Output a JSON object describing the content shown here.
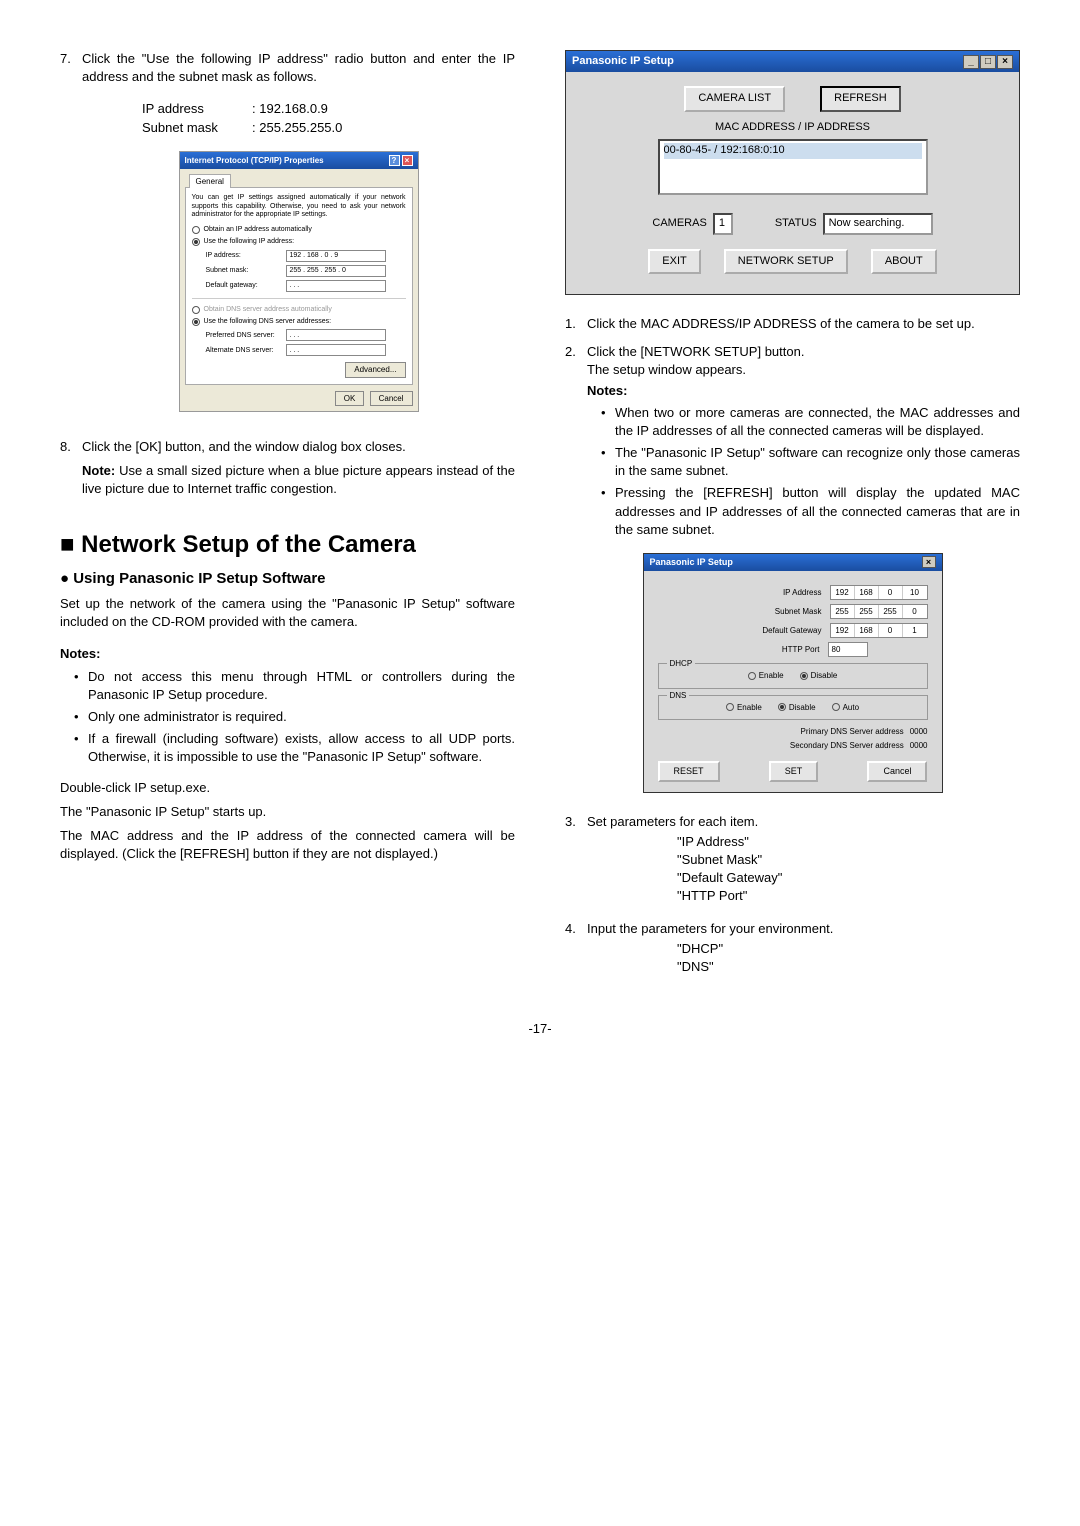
{
  "page_number": "-17-",
  "left": {
    "step7": {
      "num": "7.",
      "text": "Click the \"Use the following IP address\" radio button and enter the IP address and the subnet mask as follows.",
      "ip_label": "IP address",
      "ip_value": "192.168.0.9",
      "mask_label": "Subnet mask",
      "mask_value": "255.255.255.0"
    },
    "tcpip": {
      "title": "Internet Protocol (TCP/IP) Properties",
      "tab": "General",
      "desc": "You can get IP settings assigned automatically if your network supports this capability. Otherwise, you need to ask your network administrator for the appropriate IP settings.",
      "r_auto": "Obtain an IP address automatically",
      "r_use": "Use the following IP address:",
      "f_ip_l": "IP address:",
      "f_ip_v": "192 . 168 .  0  .  9",
      "f_mask_l": "Subnet mask:",
      "f_mask_v": "255 . 255 . 255 .  0",
      "f_gw_l": "Default gateway:",
      "f_gw_v": " .       .       .  ",
      "r_dns_auto": "Obtain DNS server address automatically",
      "r_dns_use": "Use the following DNS server addresses:",
      "f_pdns_l": "Preferred DNS server:",
      "f_adns_l": "Alternate DNS server:",
      "btn_adv": "Advanced...",
      "btn_ok": "OK",
      "btn_cancel": "Cancel"
    },
    "step8": {
      "num": "8.",
      "text": "Click the [OK] button, and the window dialog box closes.",
      "note_label": "Note:",
      "note_text": " Use a small sized picture when a blue picture appears instead of the live picture due to Internet traffic congestion."
    },
    "heading": "■ Network Setup of the Camera",
    "subheading": "● Using Panasonic IP Setup Software",
    "intro": "Set up the network of the camera using the \"Panasonic IP Setup\" software included on the CD-ROM provided with the camera.",
    "notes_hd": "Notes:",
    "notes": [
      "Do not access this menu through HTML or controllers during the Panasonic IP Setup procedure.",
      "Only one administrator is required.",
      "If a firewall (including software) exists, allow access to all UDP ports. Otherwise, it is impossible to use the \"Panasonic IP Setup\" software."
    ],
    "dc1": "Double-click IP setup.exe.",
    "dc2": "The \"Panasonic IP Setup\" starts up.",
    "dc3": "The MAC address and the IP address of the connected camera will be displayed. (Click the [REFRESH] button if they are not displayed.)"
  },
  "right": {
    "panawin": {
      "title": "Panasonic IP Setup",
      "btn_camlist": "CAMERA LIST",
      "btn_refresh": "REFRESH",
      "mac_label": "MAC ADDRESS / IP ADDRESS",
      "list_item": "00-80-45-            / 192:168:0:10",
      "cameras_l": "CAMERAS",
      "cameras_v": "1",
      "status_l": "STATUS",
      "status_v": "Now searching.",
      "btn_exit": "EXIT",
      "btn_netsetup": "NETWORK SETUP",
      "btn_about": "ABOUT"
    },
    "step1": {
      "num": "1.",
      "text": "Click the MAC ADDRESS/IP ADDRESS of the camera to be set up."
    },
    "step2": {
      "num": "2.",
      "text": "Click the [NETWORK SETUP] button.",
      "sub": "The setup window appears.",
      "notes_hd": "Notes:",
      "bullets": [
        "When two or more cameras are connected, the MAC addresses and the IP addresses of all the connected cameras will be displayed.",
        "The \"Panasonic IP Setup\" software can recognize only those cameras in the same subnet.",
        "Pressing the [REFRESH] button will display the updated MAC addresses and IP addresses of all the connected cameras that are in the same subnet."
      ]
    },
    "setupwin": {
      "title": "Panasonic IP Setup",
      "f_ip_l": "IP Address",
      "f_ip": [
        "192",
        "168",
        "0",
        "10"
      ],
      "f_mask_l": "Subnet Mask",
      "f_mask": [
        "255",
        "255",
        "255",
        "0"
      ],
      "f_gw_l": "Default Gateway",
      "f_gw": [
        "192",
        "168",
        "0",
        "1"
      ],
      "f_port_l": "HTTP Port",
      "f_port": "80",
      "g_dhcp": "DHCP",
      "dhcp_en": "Enable",
      "dhcp_dis": "Disable",
      "g_dns": "DNS",
      "dns_en": "Enable",
      "dns_dis": "Disable",
      "dns_auto": "Auto",
      "pdns_l": "Primary DNS Server address",
      "pdns": [
        "0",
        "0",
        "0",
        "0"
      ],
      "sdns_l": "Secondary DNS Server address",
      "sdns": [
        "0",
        "0",
        "0",
        "0"
      ],
      "btn_reset": "RESET",
      "btn_set": "SET",
      "btn_cancel": "Cancel"
    },
    "step3": {
      "num": "3.",
      "text": "Set parameters for each item.",
      "p": [
        "\"IP Address\"",
        "\"Subnet Mask\"",
        "\"Default Gateway\"",
        "\"HTTP Port\""
      ]
    },
    "step4": {
      "num": "4.",
      "text": "Input the parameters for your environment.",
      "p": [
        "\"DHCP\"",
        "\"DNS\""
      ]
    }
  }
}
